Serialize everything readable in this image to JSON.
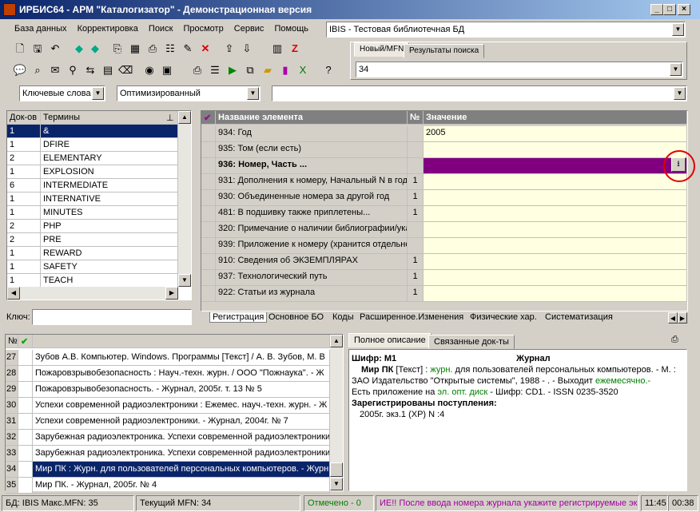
{
  "window": {
    "title": "ИРБИС64 - АРМ \"Каталогизатор\" - Демонстрационная версия"
  },
  "menu": [
    "База данных",
    "Корректировка",
    "Поиск",
    "Просмотр",
    "Сервис",
    "Помощь"
  ],
  "database_combo": "IBIS - Тестовая библиотечная БД",
  "right_tabs": [
    "Новый/MFN",
    "Результаты поиска"
  ],
  "mfn_value": "34",
  "search": {
    "mode": "Ключевые слова",
    "strategy": "Оптимизированный",
    "query": ""
  },
  "dictionary": {
    "headers": [
      "Док-ов",
      "Термины"
    ],
    "rows": [
      {
        "count": "1",
        "term": "&"
      },
      {
        "count": "1",
        "term": "DFIRE"
      },
      {
        "count": "2",
        "term": "ELEMENTARY"
      },
      {
        "count": "1",
        "term": "EXPLOSION"
      },
      {
        "count": "6",
        "term": "INTERMEDIATE"
      },
      {
        "count": "1",
        "term": "INTERNATIVE"
      },
      {
        "count": "1",
        "term": "MINUTES"
      },
      {
        "count": "2",
        "term": "PHP"
      },
      {
        "count": "2",
        "term": "PRE"
      },
      {
        "count": "1",
        "term": "REWARD"
      },
      {
        "count": "1",
        "term": "SAFETY"
      },
      {
        "count": "1",
        "term": "TEACH"
      }
    ],
    "key_label": "Ключ:"
  },
  "editor": {
    "headers": [
      "Название элемента",
      "№",
      "Значение"
    ],
    "rows": [
      {
        "name": "934: Год",
        "num": "",
        "value": "2005"
      },
      {
        "name": "935: Том (если есть)",
        "num": "",
        "value": ""
      },
      {
        "name": "936: Номер, Часть ...",
        "num": "",
        "value": ""
      },
      {
        "name": "931: Дополнения к номеру, Начальный N в году",
        "num": "1",
        "value": ""
      },
      {
        "name": "930: Объединенные номера за другой год",
        "num": "1",
        "value": ""
      },
      {
        "name": "481: В подшивку также приплетены...",
        "num": "1",
        "value": ""
      },
      {
        "name": "320: Примечание о наличии библиографии/указ",
        "num": "",
        "value": ""
      },
      {
        "name": "939: Приложение к номеру (хранится отдельно",
        "num": "",
        "value": ""
      },
      {
        "name": "910: Сведения  об ЭКЗЕМПЛЯРАХ",
        "num": "1",
        "value": ""
      },
      {
        "name": "937: Технологический путь",
        "num": "1",
        "value": ""
      },
      {
        "name": "922: Статьи из журнала",
        "num": "1",
        "value": ""
      }
    ],
    "tabs": [
      "Регистрация",
      "Основное БО",
      "Коды",
      "Расширенное.Изменения",
      "Физические хар.",
      "Систематизация"
    ]
  },
  "records": {
    "rows": [
      {
        "n": "27",
        "text": "Зубов А.В. Компьютер. Windows. Программы [Текст] / А. В. Зубов, М. В"
      },
      {
        "n": "28",
        "text": "Пожаровзрывобезопасность : Науч.-техн. журн. / ООО \"Пожнаука\". - Ж"
      },
      {
        "n": "29",
        "text": "Пожаровзрывобезопасность. - Журнал, 2005г. т. 13 № 5"
      },
      {
        "n": "30",
        "text": "Успехи современной радиоэлектроники : Ежемес. науч.-техн. журн. - Ж"
      },
      {
        "n": "31",
        "text": "Успехи современной радиоэлектроники. - Журнал, 2004г. № 7"
      },
      {
        "n": "32",
        "text": "Зарубежная радиоэлектроника. Успехи современной радиоэлектроники"
      },
      {
        "n": "33",
        "text": "Зарубежная радиоэлектроника. Успехи современной радиоэлектроники"
      },
      {
        "n": "34",
        "text": "Мир ПК : Журн. для пользователей персональных компьютеров. - Журн"
      },
      {
        "n": "35",
        "text": "Мир ПК. - Журнал, 2005г. № 4"
      }
    ],
    "header_n": "№"
  },
  "description": {
    "tabs": [
      "Полное описание",
      "Связанные док-ты"
    ],
    "shifr": "Шифр: М1",
    "type": "Журнал",
    "line1a": "Мир ПК",
    "line1b": " [Текст] : ",
    "line1c": "журн.",
    "line1d": " для пользователей персональных компьютеров. - М. :",
    "line2a": "ЗАО Издательство \"Открытые системы\", 1988 -      . - Выходит ",
    "line2b": "ежемесячно.-",
    "line3a": "Есть приложение  на ",
    "line3b": "эл. опт. диск",
    "line3c": " - Шифр: CD1. - ISSN 0235-3520",
    "reg_title": "Зарегистрированы поступления:",
    "reg_line": "2005г. экз.1 (ХР) N :4"
  },
  "statusbar": {
    "db": "БД: IBIS Макс.MFN: 35",
    "current": "Текущий MFN: 34",
    "marked": "Отмечено - 0",
    "hint": "ИЕ!!  После ввода номера журнала укажите регистрируемые эк",
    "time1": "11:45",
    "time2": "00:38"
  },
  "colors": {
    "selection": "#0a246a",
    "highlight_row": "#800080",
    "cell_bg": "#ffffe1",
    "title_from": "#0a246a"
  }
}
